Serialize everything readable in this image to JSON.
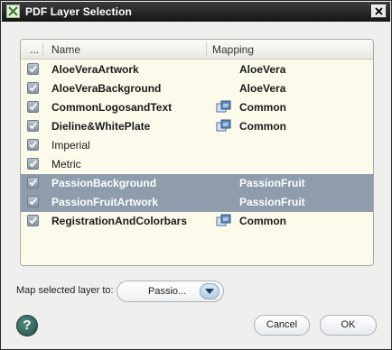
{
  "window": {
    "title": "PDF Layer Selection"
  },
  "table": {
    "columns": [
      {
        "label": "..."
      },
      {
        "label": "Name"
      },
      {
        "label": "Mapping"
      }
    ],
    "rows": [
      {
        "name": "AloeVeraArtwork",
        "mapping": "AloeVera",
        "checked": true,
        "bold": true,
        "selected": false,
        "mapping_icon": false
      },
      {
        "name": "AloeVeraBackground",
        "mapping": "AloeVera",
        "checked": true,
        "bold": true,
        "selected": false,
        "mapping_icon": false
      },
      {
        "name": "CommonLogosandText",
        "mapping": "Common",
        "checked": true,
        "bold": true,
        "selected": false,
        "mapping_icon": true
      },
      {
        "name": "Dieline&WhitePlate",
        "mapping": "Common",
        "checked": true,
        "bold": true,
        "selected": false,
        "mapping_icon": true
      },
      {
        "name": "Imperial",
        "mapping": "",
        "checked": true,
        "bold": false,
        "selected": false,
        "mapping_icon": false
      },
      {
        "name": "Metric",
        "mapping": "",
        "checked": true,
        "bold": false,
        "selected": false,
        "mapping_icon": false
      },
      {
        "name": "PassionBackground",
        "mapping": "PassionFruit",
        "checked": true,
        "bold": true,
        "selected": true,
        "mapping_icon": false
      },
      {
        "name": "PassionFruitArtwork",
        "mapping": "PassionFruit",
        "checked": true,
        "bold": true,
        "selected": true,
        "mapping_icon": false
      },
      {
        "name": "RegistrationAndColorbars",
        "mapping": "Common",
        "checked": true,
        "bold": true,
        "selected": false,
        "mapping_icon": true
      }
    ]
  },
  "map_control": {
    "label": "Map selected layer to:",
    "value": "Passio..."
  },
  "buttons": {
    "help": "?",
    "cancel": "Cancel",
    "ok": "OK"
  },
  "icons": {
    "app": "app-icon",
    "close": "close-icon",
    "checkbox": "check-icon",
    "mapping": "mapping-link-icon",
    "dropdown": "chevron-down-icon",
    "help": "help-icon"
  },
  "colors": {
    "titlebar": "#1f1f1f",
    "selection": "#8e9cab",
    "list_background": "#fcfaeb",
    "help_button": "#2f5e56"
  }
}
